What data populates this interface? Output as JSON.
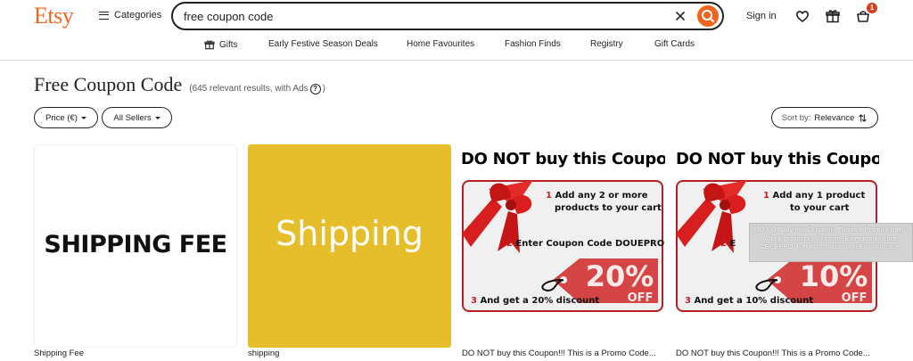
{
  "header": {
    "logo": "Etsy",
    "categories_label": "Categories",
    "search": {
      "value": "free coupon code",
      "placeholder": ""
    },
    "signin_label": "Sign in",
    "cart_count": "1"
  },
  "nav": {
    "items": [
      {
        "label": "Gifts",
        "icon": "gift-icon"
      },
      {
        "label": "Early Festive Season Deals"
      },
      {
        "label": "Home Favourites"
      },
      {
        "label": "Fashion Finds"
      },
      {
        "label": "Registry"
      },
      {
        "label": "Gift Cards"
      }
    ]
  },
  "results": {
    "title": "Free Coupon Code",
    "count_text": "(645 relevant results, with Ads",
    "count_close": ")",
    "help_glyph": "?"
  },
  "filters": {
    "price_label": "Price (€)",
    "sellers_label": "All Sellers",
    "sort_prefix": "Sort by:",
    "sort_value": "Relevance"
  },
  "listings": [
    {
      "image_text": "SHIPPING FEE",
      "title": "Shipping Fee"
    },
    {
      "image_text": "Shipping",
      "title": "shipping"
    },
    {
      "image_title": "DO NOT buy this Coupon",
      "step1_num": "1",
      "step1_a": "Add any 2 or more",
      "step1_b": "products to your cart",
      "step2_num": "2",
      "step2": "Enter Coupon Code DOUEPRO",
      "step3_num": "3",
      "step3": "And get a 20% discount",
      "tag_pct": "20%",
      "tag_off": "OFF",
      "title": "DO NOT buy this Coupon!!! This is a Promo Code..."
    },
    {
      "image_title": "DO NOT buy this Coupon!",
      "step1_num": "1",
      "step1_a": "Add any 1 product",
      "step1_b": "to your cart",
      "step2_num": "2",
      "step2": "E",
      "step3_num": "3",
      "step3": "And get a 10% discount",
      "tag_pct": "10%",
      "tag_off": "OFF",
      "title": "DO NOT buy this Coupon!!! This is a Promo Code..."
    }
  ],
  "tooltip": {
    "text": "DO NOT buy this Coupon!!! This is a Promo Code!!! Add 1 product to your cart. Enter promo code ZECEPRO. Get a 10% discount! Buy and save!"
  },
  "colors": {
    "brand": "#f1641e",
    "badge": "#d63e1c",
    "tile_yellow": "#e6bd2a",
    "coupon_red": "#c8201e"
  }
}
